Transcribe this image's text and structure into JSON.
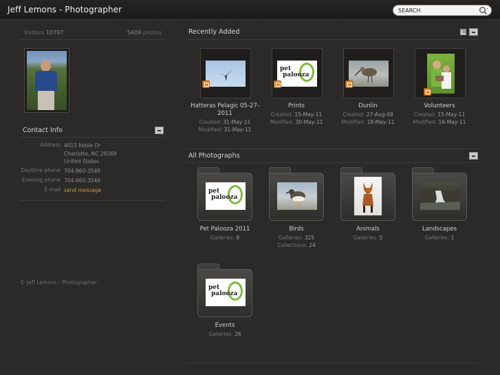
{
  "header": {
    "site_title": "Jeff Lemons - Photographer",
    "search_placeholder": "SEARCH"
  },
  "sidebar": {
    "visitors_label": "Visitors",
    "visitors_count": "10797",
    "photos_count": "5609",
    "photos_label": "photos",
    "contact": {
      "title": "Contact Info",
      "address_label": "Address",
      "address_line1": "4015 Keble Dr",
      "address_line2": "Charlotte, NC 28269",
      "address_line3": "United States",
      "daytime_label": "Daytime phone",
      "daytime_value": "704-860-3546",
      "evening_label": "Evening phone",
      "evening_value": "704-860-3546",
      "email_label": "E-mail",
      "email_value": "send message"
    },
    "footer": "© Jeff Lemons - Photographer"
  },
  "recently_added": {
    "title": "Recently Added",
    "items": [
      {
        "title": "Hatteras Pelagic 05-27-2011",
        "created_label": "Created:",
        "created": "31-May-11",
        "modified_label": "Modified:",
        "modified": "31-May-11"
      },
      {
        "title": "Prints",
        "created_label": "Created:",
        "created": "15-May-11",
        "modified_label": "Modified:",
        "modified": "30-May-11"
      },
      {
        "title": "Dunlin",
        "created_label": "Created:",
        "created": "27-Aug-08",
        "modified_label": "Modified:",
        "modified": "18-May-11"
      },
      {
        "title": "Volunteers",
        "created_label": "Created:",
        "created": "15-May-11",
        "modified_label": "Modified:",
        "modified": "16-May-11"
      }
    ]
  },
  "all_photographs": {
    "title": "All Photographs",
    "items": [
      {
        "title": "Pet Palooza 2011",
        "line1_label": "Galleries:",
        "line1": "8",
        "line2_label": "",
        "line2": ""
      },
      {
        "title": "Birds",
        "line1_label": "Galleries:",
        "line1": "325",
        "line2_label": "Collections:",
        "line2": "24"
      },
      {
        "title": "Animals",
        "line1_label": "Galleries:",
        "line1": "5",
        "line2_label": "",
        "line2": ""
      },
      {
        "title": "Landscapes",
        "line1_label": "Galleries:",
        "line1": "1",
        "line2_label": "",
        "line2": ""
      },
      {
        "title": "Events",
        "line1_label": "Galleries:",
        "line1": "26",
        "line2_label": "",
        "line2": ""
      }
    ]
  },
  "logo_text": {
    "pet": "pet",
    "palooza": "palooza"
  },
  "colors": {
    "background": "#2b2a28",
    "accent_link": "#c99a3e",
    "badge": "#e6862a"
  }
}
